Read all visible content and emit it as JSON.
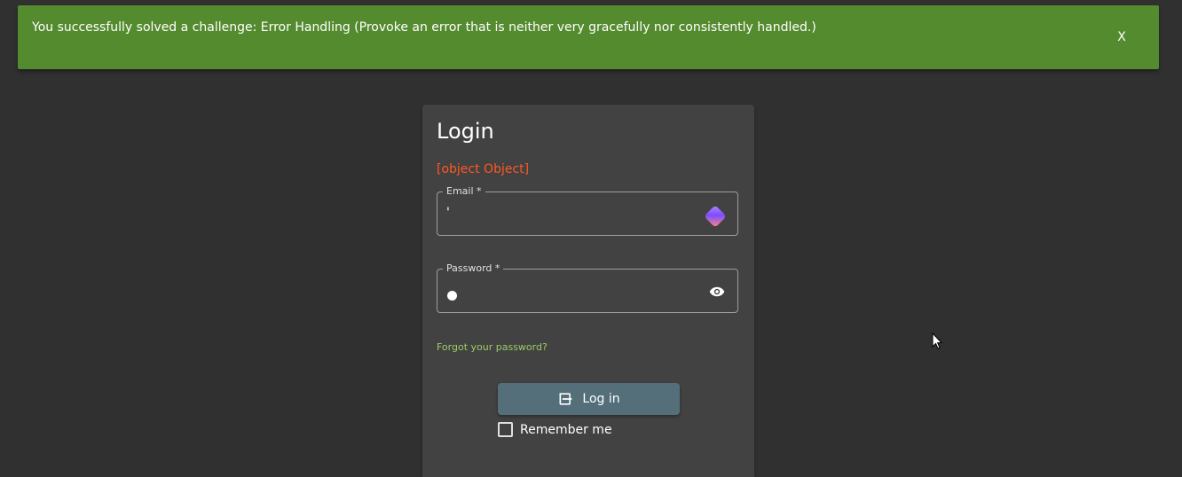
{
  "notification": {
    "message": "You successfully solved a challenge: Error Handling (Provoke an error that is neither very gracefully nor consistently handled.)",
    "close_label": "X",
    "color": "#558b2f"
  },
  "login": {
    "title": "Login",
    "error": "[object Object]",
    "email": {
      "label": "Email *",
      "value": "'",
      "extension_icon": "password-manager-icon"
    },
    "password": {
      "label": "Password *",
      "masked": true,
      "toggle_icon": "eye-icon"
    },
    "forgot_password": "Forgot your password?",
    "login_button": "Log in",
    "login_button_icon": "login-icon",
    "remember_me": "Remember me",
    "remember_me_checked": false
  },
  "colors": {
    "background": "#303030",
    "card": "#424242",
    "error": "#ff5722",
    "link": "#9ccc65",
    "button": "#546e7a"
  }
}
